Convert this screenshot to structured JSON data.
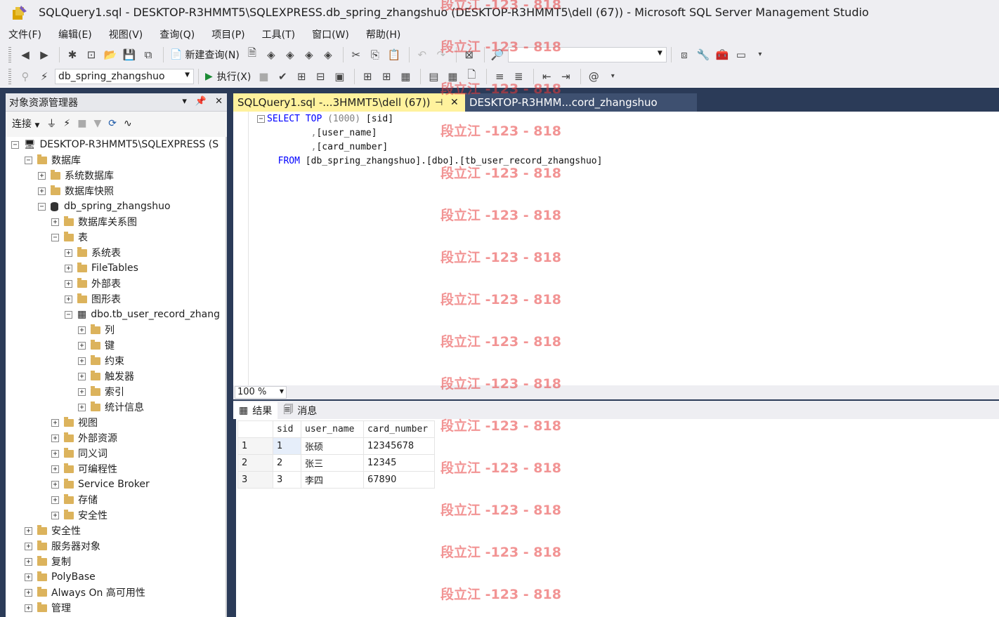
{
  "window": {
    "title": "SQLQuery1.sql - DESKTOP-R3HMMT5\\SQLEXPRESS.db_spring_zhangshuo (DESKTOP-R3HMMT5\\dell (67)) - Microsoft SQL Server Management Studio"
  },
  "menu": [
    "文件(F)",
    "编辑(E)",
    "视图(V)",
    "查询(Q)",
    "项目(P)",
    "工具(T)",
    "窗口(W)",
    "帮助(H)"
  ],
  "toolbar": {
    "new_query": "新建查询(N)",
    "execute": "执行(X)",
    "database": "db_spring_zhangshuo",
    "search_value": ""
  },
  "object_explorer": {
    "title": "对象资源管理器",
    "connect": "连接",
    "tree": [
      {
        "label": "DESKTOP-R3HMMT5\\SQLEXPRESS (S",
        "icon": "server-icon",
        "level": 0,
        "expanded": true
      },
      {
        "label": "数据库",
        "icon": "folder-icon",
        "level": 1,
        "expanded": true
      },
      {
        "label": "系统数据库",
        "icon": "folder-icon",
        "level": 2,
        "expanded": false
      },
      {
        "label": "数据库快照",
        "icon": "folder-icon",
        "level": 2,
        "expanded": false
      },
      {
        "label": "db_spring_zhangshuo",
        "icon": "database-icon",
        "level": 2,
        "expanded": true
      },
      {
        "label": "数据库关系图",
        "icon": "folder-icon",
        "level": 3,
        "expanded": false
      },
      {
        "label": "表",
        "icon": "folder-icon",
        "level": 3,
        "expanded": true
      },
      {
        "label": "系统表",
        "icon": "folder-icon",
        "level": 4,
        "expanded": false
      },
      {
        "label": "FileTables",
        "icon": "folder-icon",
        "level": 4,
        "expanded": false
      },
      {
        "label": "外部表",
        "icon": "folder-icon",
        "level": 4,
        "expanded": false
      },
      {
        "label": "图形表",
        "icon": "folder-icon",
        "level": 4,
        "expanded": false
      },
      {
        "label": "dbo.tb_user_record_zhang",
        "icon": "table-icon",
        "level": 4,
        "expanded": true
      },
      {
        "label": "列",
        "icon": "folder-icon",
        "level": 5,
        "expanded": false
      },
      {
        "label": "键",
        "icon": "folder-icon",
        "level": 5,
        "expanded": false
      },
      {
        "label": "约束",
        "icon": "folder-icon",
        "level": 5,
        "expanded": false
      },
      {
        "label": "触发器",
        "icon": "folder-icon",
        "level": 5,
        "expanded": false
      },
      {
        "label": "索引",
        "icon": "folder-icon",
        "level": 5,
        "expanded": false
      },
      {
        "label": "统计信息",
        "icon": "folder-icon",
        "level": 5,
        "expanded": false
      },
      {
        "label": "视图",
        "icon": "folder-icon",
        "level": 3,
        "expanded": false
      },
      {
        "label": "外部资源",
        "icon": "folder-icon",
        "level": 3,
        "expanded": false
      },
      {
        "label": "同义词",
        "icon": "folder-icon",
        "level": 3,
        "expanded": false
      },
      {
        "label": "可编程性",
        "icon": "folder-icon",
        "level": 3,
        "expanded": false
      },
      {
        "label": "Service Broker",
        "icon": "folder-icon",
        "level": 3,
        "expanded": false
      },
      {
        "label": "存储",
        "icon": "folder-icon",
        "level": 3,
        "expanded": false
      },
      {
        "label": "安全性",
        "icon": "folder-icon",
        "level": 3,
        "expanded": false
      },
      {
        "label": "安全性",
        "icon": "folder-icon",
        "level": 1,
        "expanded": false
      },
      {
        "label": "服务器对象",
        "icon": "folder-icon",
        "level": 1,
        "expanded": false
      },
      {
        "label": "复制",
        "icon": "folder-icon",
        "level": 1,
        "expanded": false
      },
      {
        "label": "PolyBase",
        "icon": "folder-icon",
        "level": 1,
        "expanded": false
      },
      {
        "label": "Always On 高可用性",
        "icon": "folder-icon",
        "level": 1,
        "expanded": false
      },
      {
        "label": "管理",
        "icon": "folder-icon",
        "level": 1,
        "expanded": false
      }
    ]
  },
  "tabs": {
    "active": "SQLQuery1.sql -...3HMMT5\\dell (67))",
    "inactive": "DESKTOP-R3HMM...cord_zhangshuo"
  },
  "editor": {
    "sql": {
      "select": "SELECT",
      "top": "TOP",
      "top_n": "(1000)",
      "col1": "[sid]",
      "col2": "[user_name]",
      "col3": "[card_number]",
      "from": "FROM",
      "table": "[db_spring_zhangshuo].[dbo].[tb_user_record_zhangshuo]"
    },
    "zoom": "100 %"
  },
  "results": {
    "tab_results": "结果",
    "tab_messages": "消息",
    "columns": [
      "sid",
      "user_name",
      "card_number"
    ],
    "rows": [
      {
        "n": "1",
        "sid": "1",
        "user_name": "张硕",
        "card_number": "12345678"
      },
      {
        "n": "2",
        "sid": "2",
        "user_name": "张三",
        "card_number": "12345"
      },
      {
        "n": "3",
        "sid": "3",
        "user_name": "李四",
        "card_number": "67890"
      }
    ]
  },
  "watermark": "段立江 -123 - 818"
}
